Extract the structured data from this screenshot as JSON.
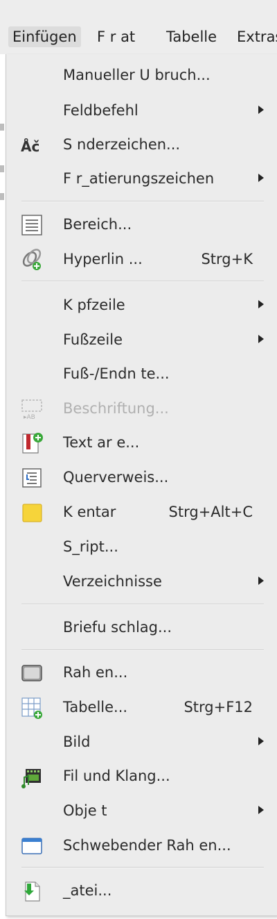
{
  "menubar": {
    "items": [
      {
        "label": "Einfügen",
        "active": true
      },
      {
        "label": "F r at"
      },
      {
        "label": "Tabelle"
      },
      {
        "label": "Extras"
      }
    ]
  },
  "menu": {
    "items": [
      {
        "label": "Manueller U bruch...",
        "has_submenu": false,
        "shortcut": "",
        "icon": "none"
      },
      {
        "label": "Feldbefehl",
        "has_submenu": true,
        "shortcut": "",
        "icon": "none"
      },
      {
        "label": "S nderzeichen...",
        "has_submenu": false,
        "shortcut": "",
        "icon": "special-character-icon"
      },
      {
        "label": "F r_atierungszeichen",
        "has_submenu": true,
        "shortcut": "",
        "icon": "none"
      },
      {
        "label": "Bereich...",
        "has_submenu": false,
        "shortcut": "",
        "icon": "section-icon"
      },
      {
        "label": "Hyperlin ...",
        "has_submenu": false,
        "shortcut": "Strg+K",
        "icon": "hyperlink-icon"
      },
      {
        "label": "K pfzeile",
        "has_submenu": true,
        "shortcut": "",
        "icon": "none"
      },
      {
        "label": "Fußzeile",
        "has_submenu": true,
        "shortcut": "",
        "icon": "none"
      },
      {
        "label": "Fuß-/Endn te...",
        "has_submenu": false,
        "shortcut": "",
        "icon": "none"
      },
      {
        "label": "Beschriftung...",
        "has_submenu": false,
        "shortcut": "",
        "icon": "caption-icon",
        "disabled": true
      },
      {
        "label": "Text ar e...",
        "has_submenu": false,
        "shortcut": "",
        "icon": "bookmark-icon"
      },
      {
        "label": "Querverweis...",
        "has_submenu": false,
        "shortcut": "",
        "icon": "cross-reference-icon"
      },
      {
        "label": "K entar",
        "has_submenu": false,
        "shortcut": "Strg+Alt+C",
        "icon": "comment-icon"
      },
      {
        "label": "S_ript...",
        "has_submenu": false,
        "shortcut": "",
        "icon": "none"
      },
      {
        "label": "Verzeichnisse",
        "has_submenu": true,
        "shortcut": "",
        "icon": "none"
      },
      {
        "label": "Briefu schlag...",
        "has_submenu": false,
        "shortcut": "",
        "icon": "none"
      },
      {
        "label": "Rah en...",
        "has_submenu": false,
        "shortcut": "",
        "icon": "frame-icon"
      },
      {
        "label": "Tabelle...",
        "has_submenu": false,
        "shortcut": "Strg+F12",
        "icon": "table-icon"
      },
      {
        "label": "Bild",
        "has_submenu": true,
        "shortcut": "",
        "icon": "none"
      },
      {
        "label": "Fil und Klang...",
        "has_submenu": false,
        "shortcut": "",
        "icon": "media-icon"
      },
      {
        "label": "Obje t",
        "has_submenu": true,
        "shortcut": "",
        "icon": "none"
      },
      {
        "label": "Schwebender Rah en...",
        "has_submenu": false,
        "shortcut": "",
        "icon": "floating-frame-icon"
      },
      {
        "label": "_atei...",
        "has_submenu": false,
        "shortcut": "",
        "icon": "insert-file-icon"
      }
    ]
  }
}
